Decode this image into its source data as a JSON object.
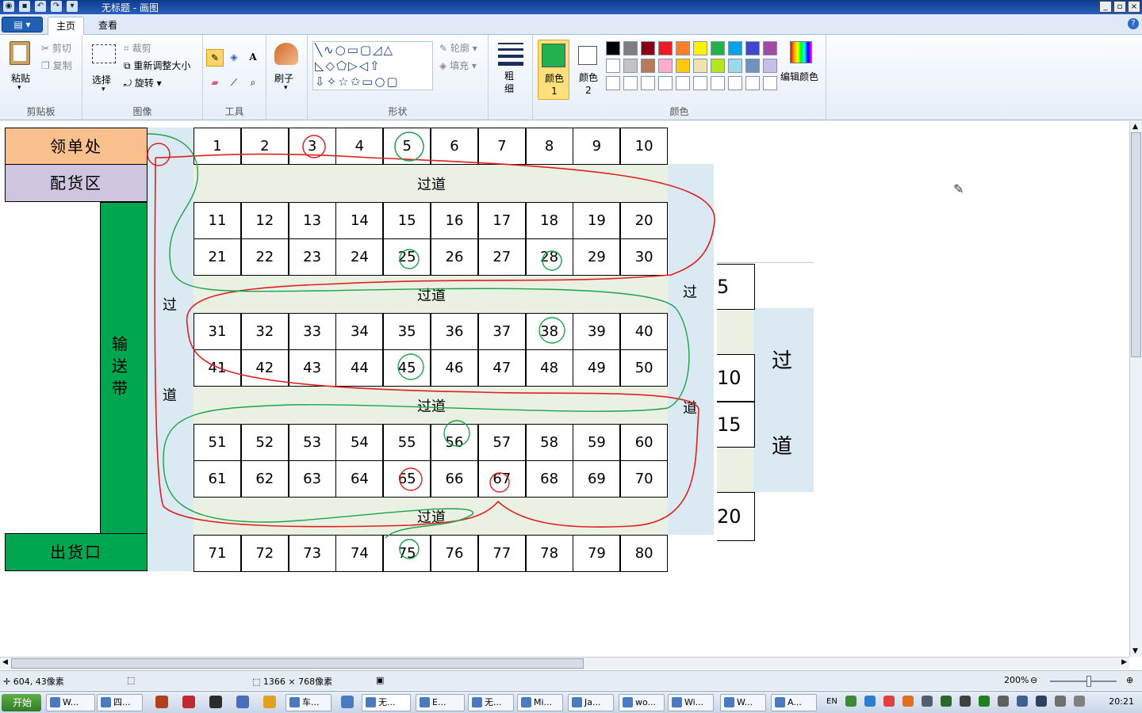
{
  "window": {
    "title": "无标题 - 画图",
    "controls": [
      "_",
      "▫",
      "×"
    ]
  },
  "tabs": {
    "file": "▤ ▾",
    "home": "主页",
    "view": "查看",
    "help": "?"
  },
  "ribbon": {
    "clipboard": {
      "paste": "粘贴",
      "cut": "剪切",
      "copy": "复制",
      "label": "剪贴板"
    },
    "image": {
      "select": "选择",
      "crop": "裁剪",
      "resize": "重新调整大小",
      "rotate": "旋转",
      "label": "图像"
    },
    "tools": {
      "label": "工具"
    },
    "brush": {
      "label": "刷子"
    },
    "shapes": {
      "outline": "轮廓",
      "fill": "填充",
      "label": "形状"
    },
    "size": {
      "label": "粗细"
    },
    "colors": {
      "color1": "颜色 1",
      "color2": "颜色 2",
      "edit": "编辑颜色",
      "label": "颜色",
      "color1_value": "#22b14c",
      "color2_value": "#ffffff",
      "palette_row1": [
        "#000000",
        "#7f7f7f",
        "#880015",
        "#ed1c24",
        "#ff7f27",
        "#fff200",
        "#22b14c",
        "#00a2e8",
        "#3f48cc",
        "#a349a4"
      ],
      "palette_row2": [
        "#ffffff",
        "#c3c3c3",
        "#b97a57",
        "#ffaec9",
        "#ffc90e",
        "#efe4b0",
        "#b5e61d",
        "#99d9ea",
        "#7092be",
        "#c8bfe7"
      ]
    }
  },
  "drawing": {
    "pickup": "领单处",
    "distribution": "配货区",
    "conveyor": [
      "输",
      "送",
      "带"
    ],
    "exit": "出货口",
    "aisle": "过道",
    "side_guo": "过",
    "side_dao": "道",
    "right_big_guo": "过",
    "right_big_dao": "道",
    "partial_numbers": [
      "5",
      "10",
      "15",
      "20"
    ],
    "row1": [
      "1",
      "2",
      "3",
      "4",
      "5",
      "6",
      "7",
      "8",
      "9",
      "10"
    ],
    "row2": [
      "11",
      "12",
      "13",
      "14",
      "15",
      "16",
      "17",
      "18",
      "19",
      "20"
    ],
    "row3": [
      "21",
      "22",
      "23",
      "24",
      "25",
      "26",
      "27",
      "28",
      "29",
      "30"
    ],
    "row4": [
      "31",
      "32",
      "33",
      "34",
      "35",
      "36",
      "37",
      "38",
      "39",
      "40"
    ],
    "row5": [
      "41",
      "42",
      "43",
      "44",
      "45",
      "46",
      "47",
      "48",
      "49",
      "50"
    ],
    "row6": [
      "51",
      "52",
      "53",
      "54",
      "55",
      "56",
      "57",
      "58",
      "59",
      "60"
    ],
    "row7": [
      "61",
      "62",
      "63",
      "64",
      "65",
      "66",
      "67",
      "68",
      "69",
      "70"
    ],
    "row8": [
      "71",
      "72",
      "73",
      "74",
      "75",
      "76",
      "77",
      "78",
      "79",
      "80"
    ]
  },
  "status": {
    "cursor_pos": "604, 43像素",
    "canvas_size": "1366 × 768像素",
    "zoom": "200%"
  },
  "taskbar": {
    "start": "开始",
    "items": [
      "W...",
      "四...",
      "车...",
      "无...",
      "E...",
      "无...",
      "Mi...",
      "Ja...",
      "wo...",
      "Wi...",
      "W...",
      "A..."
    ],
    "lang": "EN",
    "time": "20:21"
  }
}
